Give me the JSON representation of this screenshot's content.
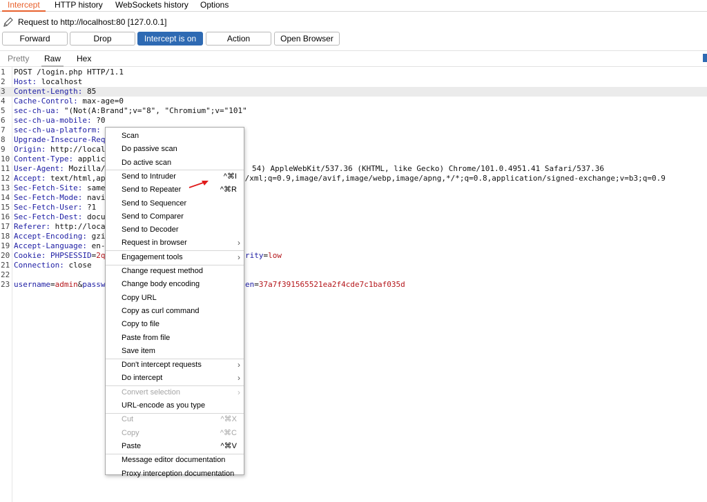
{
  "tabs": [
    "Intercept",
    "HTTP history",
    "WebSockets history",
    "Options"
  ],
  "request_info": {
    "text": "Request to http://localhost:80  [127.0.0.1]"
  },
  "buttons": {
    "forward": "Forward",
    "drop": "Drop",
    "intercept": "Intercept is on",
    "action": "Action",
    "open_browser": "Open Browser"
  },
  "subtabs": [
    "Pretty",
    "Raw",
    "Hex"
  ],
  "request_lines": [
    {
      "n": "1",
      "key": "",
      "val": "POST /login.php HTTP/1.1"
    },
    {
      "n": "2",
      "key": "Host:",
      "val": " localhost"
    },
    {
      "n": "3",
      "key": "Content-Length:",
      "val": " 85"
    },
    {
      "n": "4",
      "key": "Cache-Control:",
      "val": " max-age=0"
    },
    {
      "n": "5",
      "key": "sec-ch-ua:",
      "val": " \"(Not(A:Brand\";v=\"8\", \"Chromium\";v=\"101\""
    },
    {
      "n": "6",
      "key": "sec-ch-ua-mobile:",
      "val": " ?0"
    },
    {
      "n": "7",
      "key": "sec-ch-ua-platform:",
      "val": ""
    },
    {
      "n": "8",
      "key": "Upgrade-Insecure-Req",
      "val": ""
    },
    {
      "n": "9",
      "key": "Origin:",
      "val": " http://local"
    },
    {
      "n": "10",
      "key": "Content-Type:",
      "val": " applic"
    },
    {
      "n": "11",
      "key": "User-Agent:",
      "val": " Mozilla/",
      "tail": "54) AppleWebKit/537.36 (KHTML, like Gecko) Chrome/101.0.4951.41 Safari/537.36"
    },
    {
      "n": "12",
      "key": "Accept:",
      "val": " text/html,ap",
      "tail": "n/xml;q=0.9,image/avif,image/webp,image/apng,*/*;q=0.8,application/signed-exchange;v=b3;q=0.9"
    },
    {
      "n": "13",
      "key": "Sec-Fetch-Site:",
      "val": " same"
    },
    {
      "n": "14",
      "key": "Sec-Fetch-Mode:",
      "val": " navi"
    },
    {
      "n": "15",
      "key": "Sec-Fetch-User:",
      "val": " ?1"
    },
    {
      "n": "16",
      "key": "Sec-Fetch-Dest:",
      "val": " docu"
    },
    {
      "n": "17",
      "key": "Referer:",
      "val": " http://loca"
    },
    {
      "n": "18",
      "key": "Accept-Encoding:",
      "val": " gzi"
    },
    {
      "n": "19",
      "key": "Accept-Language:",
      "val": " en-"
    },
    {
      "n": "20",
      "key": "Cookie:",
      "val": " ",
      "cookie_name": "PHPSESSID",
      "cookie_eq": "=",
      "cookie_val": "2q",
      "tail_param": "rity",
      "tail_eq": "=",
      "tail_val": "low"
    },
    {
      "n": "21",
      "key": "Connection:",
      "val": " close"
    },
    {
      "n": "22",
      "key": "",
      "val": ""
    },
    {
      "n": "23",
      "body": true,
      "p1": "username",
      "e1": "=",
      "v1": "admin",
      "amp": "&",
      "p2": "passw",
      "p3": "en",
      "e3": "=",
      "v3": "37a7f391565521ea2f4cde7c1baf035d"
    }
  ],
  "context_menu": [
    {
      "label": "Scan"
    },
    {
      "label": "Do passive scan"
    },
    {
      "label": "Do active scan"
    },
    {
      "sep": true
    },
    {
      "label": "Send to Intruder",
      "shortcut": "^⌘I"
    },
    {
      "label": "Send to Repeater",
      "shortcut": "^⌘R"
    },
    {
      "label": "Send to Sequencer"
    },
    {
      "label": "Send to Comparer"
    },
    {
      "label": "Send to Decoder"
    },
    {
      "label": "Request in browser",
      "submenu": true
    },
    {
      "sep": true
    },
    {
      "label": "Engagement tools",
      "submenu": true
    },
    {
      "sep": true
    },
    {
      "label": "Change request method"
    },
    {
      "label": "Change body encoding"
    },
    {
      "label": "Copy URL"
    },
    {
      "label": "Copy as curl command"
    },
    {
      "label": "Copy to file"
    },
    {
      "label": "Paste from file"
    },
    {
      "label": "Save item"
    },
    {
      "sep": true
    },
    {
      "label": "Don't intercept requests",
      "submenu": true
    },
    {
      "label": "Do intercept",
      "submenu": true
    },
    {
      "sep": true
    },
    {
      "label": "Convert selection",
      "submenu": true,
      "disabled": true
    },
    {
      "label": "URL-encode as you type"
    },
    {
      "sep": true
    },
    {
      "label": "Cut",
      "shortcut": "^⌘X",
      "disabled": true
    },
    {
      "label": "Copy",
      "shortcut": "^⌘C",
      "disabled": true
    },
    {
      "label": "Paste",
      "shortcut": "^⌘V"
    },
    {
      "sep": true
    },
    {
      "label": "Message editor documentation"
    },
    {
      "label": "Proxy interception documentation"
    }
  ],
  "colors": {
    "accent_orange": "#e8602c",
    "intercept_blue": "#2e6ab3",
    "header_key": "#1c1ca3",
    "param_value": "#b4151a",
    "annotation_arrow": "#e01b1b"
  }
}
